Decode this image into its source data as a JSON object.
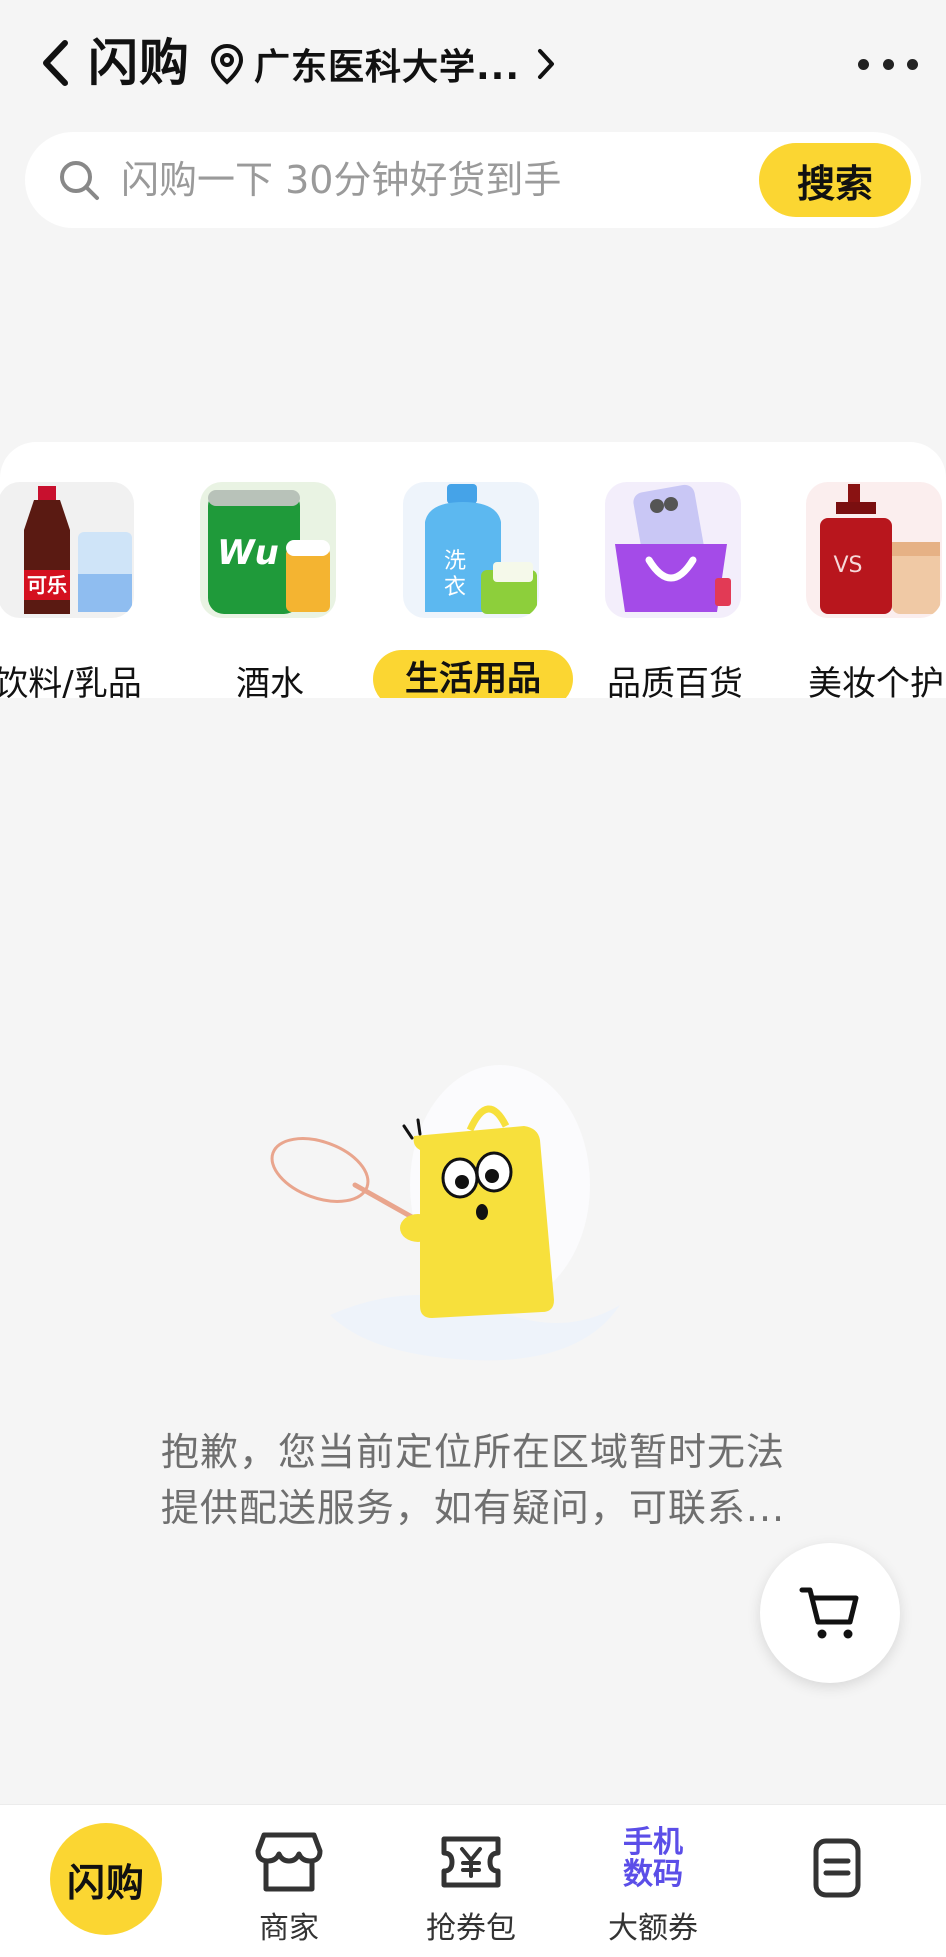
{
  "header": {
    "title": "闪购",
    "location": "广东医科大学...",
    "back_icon": "chevron-left-icon",
    "more_icon": "more-dots-icon"
  },
  "search": {
    "placeholder": "闪购一下 30分钟好货到手",
    "button_label": "搜索"
  },
  "categories": [
    {
      "label": "饮料/乳品",
      "icon": "cola-bottle-icon",
      "active": false
    },
    {
      "label": "酒水",
      "icon": "beer-can-icon",
      "active": false
    },
    {
      "label": "生活用品",
      "icon": "detergent-bottle-icon",
      "active": true
    },
    {
      "label": "品质百货",
      "icon": "shopping-bag-phone-icon",
      "active": false
    },
    {
      "label": "美妆个护",
      "icon": "cosmetics-bottle-icon",
      "active": false
    }
  ],
  "empty_state": {
    "line1": "抱歉，您当前定位所在区域暂时无法",
    "line2": "提供配送服务，如有疑问，可联系..."
  },
  "tabbar": {
    "items": [
      {
        "label": "闪购",
        "icon": "flash-buy-badge"
      },
      {
        "label": "商家",
        "icon": "store-icon"
      },
      {
        "label": "抢券包",
        "icon": "coupon-yen-icon"
      },
      {
        "label": "大额券",
        "icon": "phone-digital-promo",
        "icon_text_1": "手机",
        "icon_text_2": "数码"
      },
      {
        "label": "",
        "icon": "order-list-icon"
      }
    ]
  },
  "colors": {
    "accent_yellow": "#fbd632",
    "promo_purple": "#5b4ee8",
    "background": "#f5f5f5"
  }
}
